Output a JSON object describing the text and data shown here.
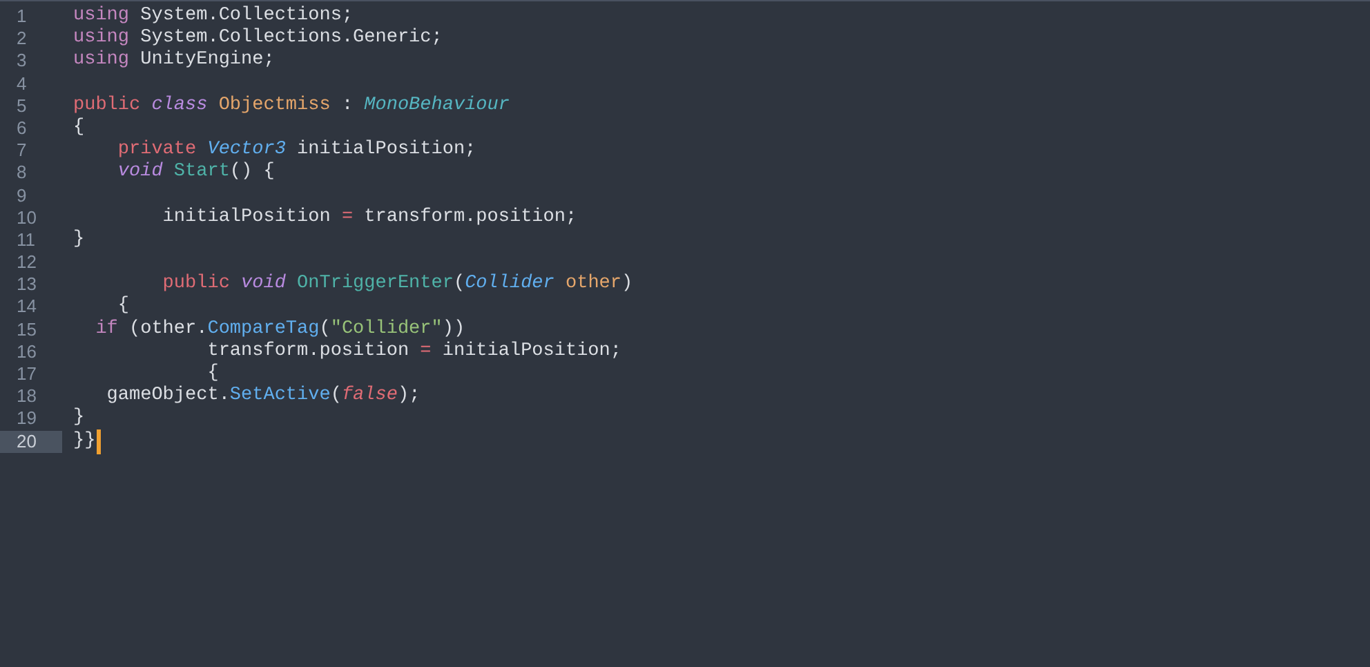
{
  "editor": {
    "lines": [
      {
        "number": "1",
        "active": false,
        "tokens": [
          {
            "kind": "keyword",
            "text": "using"
          },
          {
            "kind": "plain",
            "text": " System.Collections;"
          }
        ]
      },
      {
        "number": "2",
        "active": false,
        "tokens": [
          {
            "kind": "keyword",
            "text": "using"
          },
          {
            "kind": "plain",
            "text": " System.Collections.Generic;"
          }
        ]
      },
      {
        "number": "3",
        "active": false,
        "tokens": [
          {
            "kind": "keyword",
            "text": "using"
          },
          {
            "kind": "plain",
            "text": " UnityEngine;"
          }
        ]
      },
      {
        "number": "4",
        "active": false
      },
      {
        "number": "5",
        "active": false,
        "tokens": [
          {
            "kind": "modifier",
            "text": "public"
          },
          {
            "kind": "storage",
            "text": " class"
          },
          {
            "kind": "class-name",
            "text": " Objectmiss"
          },
          {
            "kind": "plain",
            "text": " : "
          },
          {
            "kind": "base-type",
            "text": "MonoBehaviour"
          }
        ]
      },
      {
        "number": "6",
        "active": false,
        "tokens": [
          {
            "kind": "plain",
            "text": "{"
          }
        ]
      },
      {
        "number": "7",
        "active": false,
        "tokens": [
          {
            "kind": "modifier",
            "text": "    private"
          },
          {
            "kind": "type",
            "text": " Vector3"
          },
          {
            "kind": "plain",
            "text": " initialPosition;"
          }
        ]
      },
      {
        "number": "8",
        "active": false,
        "tokens": [
          {
            "kind": "storage",
            "text": "    void"
          },
          {
            "kind": "function",
            "text": " Start"
          },
          {
            "kind": "plain",
            "text": "() {"
          }
        ]
      },
      {
        "number": "9",
        "active": false
      },
      {
        "number": "10",
        "active": false,
        "tokens": [
          {
            "kind": "plain",
            "text": "        initialPosition "
          },
          {
            "kind": "operator",
            "text": "="
          },
          {
            "kind": "plain",
            "text": " transform.position;"
          }
        ]
      },
      {
        "number": "11",
        "active": false,
        "tokens": [
          {
            "kind": "plain",
            "text": "}"
          }
        ]
      },
      {
        "number": "12",
        "active": false
      },
      {
        "number": "13",
        "active": false,
        "tokens": [
          {
            "kind": "modifier",
            "text": "        public"
          },
          {
            "kind": "storage",
            "text": " void"
          },
          {
            "kind": "function",
            "text": " OnTriggerEnter"
          },
          {
            "kind": "plain",
            "text": "("
          },
          {
            "kind": "type",
            "text": "Collider"
          },
          {
            "kind": "param",
            "text": " other"
          },
          {
            "kind": "plain",
            "text": ")"
          }
        ]
      },
      {
        "number": "14",
        "active": false,
        "tokens": [
          {
            "kind": "plain",
            "text": "    {"
          }
        ]
      },
      {
        "number": "15",
        "active": false,
        "tokens": [
          {
            "kind": "keyword",
            "text": "  if"
          },
          {
            "kind": "plain",
            "text": " (other."
          },
          {
            "kind": "method",
            "text": "CompareTag"
          },
          {
            "kind": "plain",
            "text": "("
          },
          {
            "kind": "string",
            "text": "\"Collider\""
          },
          {
            "kind": "plain",
            "text": "))"
          }
        ]
      },
      {
        "number": "16",
        "active": false,
        "tokens": [
          {
            "kind": "plain",
            "text": "            transform.position "
          },
          {
            "kind": "operator",
            "text": "="
          },
          {
            "kind": "plain",
            "text": " initialPosition;"
          }
        ]
      },
      {
        "number": "17",
        "active": false,
        "tokens": [
          {
            "kind": "plain",
            "text": "            {"
          }
        ]
      },
      {
        "number": "18",
        "active": false,
        "tokens": [
          {
            "kind": "plain",
            "text": "   gameObject."
          },
          {
            "kind": "method",
            "text": "SetActive"
          },
          {
            "kind": "plain",
            "text": "("
          },
          {
            "kind": "constant",
            "text": "false"
          },
          {
            "kind": "plain",
            "text": ");"
          }
        ]
      },
      {
        "number": "19",
        "active": false,
        "tokens": [
          {
            "kind": "plain",
            "text": "}"
          }
        ]
      },
      {
        "number": "20",
        "active": true,
        "cursor": true,
        "tokens": [
          {
            "kind": "plain",
            "text": "}}"
          }
        ]
      }
    ]
  }
}
